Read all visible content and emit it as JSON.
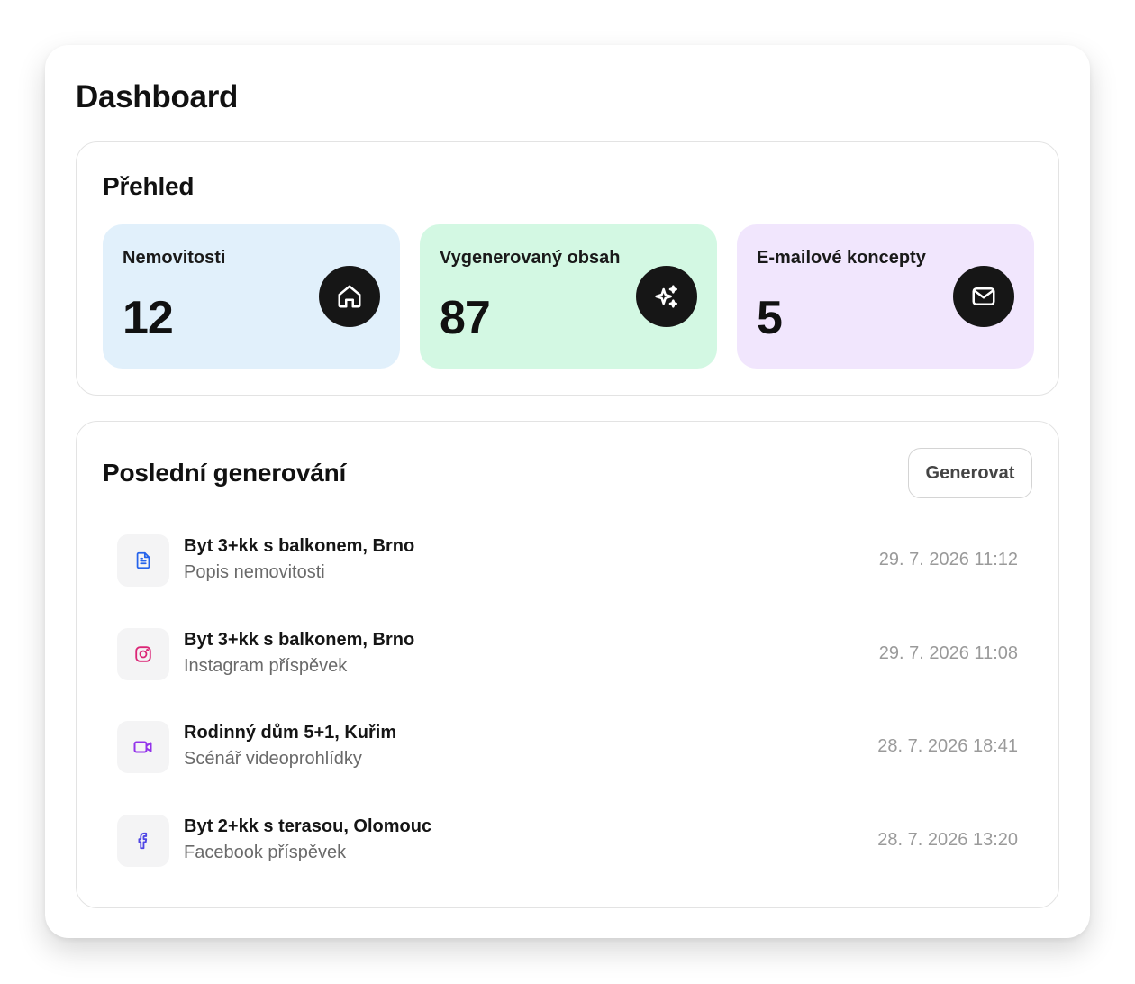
{
  "page_title": "Dashboard",
  "overview": {
    "title": "Přehled",
    "stats": [
      {
        "label": "Nemovitosti",
        "value": "12",
        "icon": "home-icon",
        "color": "#e1f0fb"
      },
      {
        "label": "Vygenerovaný obsah",
        "value": "87",
        "icon": "sparkles-icon",
        "color": "#d3f8e3"
      },
      {
        "label": "E-mailové koncepty",
        "value": "5",
        "icon": "mail-icon",
        "color": "#f1e6fd"
      }
    ]
  },
  "recent": {
    "title": "Poslední generování",
    "generate_label": "Generovat",
    "items": [
      {
        "title": "Byt 3+kk s balkonem, Brno",
        "subtitle": "Popis nemovitosti",
        "time": "29. 7. 2026 11:12",
        "icon": "document-icon",
        "icon_color": "#2563eb"
      },
      {
        "title": "Byt 3+kk s balkonem, Brno",
        "subtitle": "Instagram příspěvek",
        "time": "29. 7. 2026 11:08",
        "icon": "instagram-icon",
        "icon_color": "#db2777"
      },
      {
        "title": "Rodinný dům 5+1, Kuřim",
        "subtitle": "Scénář videoprohlídky",
        "time": "28. 7. 2026 18:41",
        "icon": "video-icon",
        "icon_color": "#9333ea"
      },
      {
        "title": "Byt 2+kk s terasou, Olomouc",
        "subtitle": "Facebook příspěvek",
        "time": "28. 7. 2026 13:20",
        "icon": "facebook-icon",
        "icon_color": "#4f46e5"
      }
    ]
  }
}
